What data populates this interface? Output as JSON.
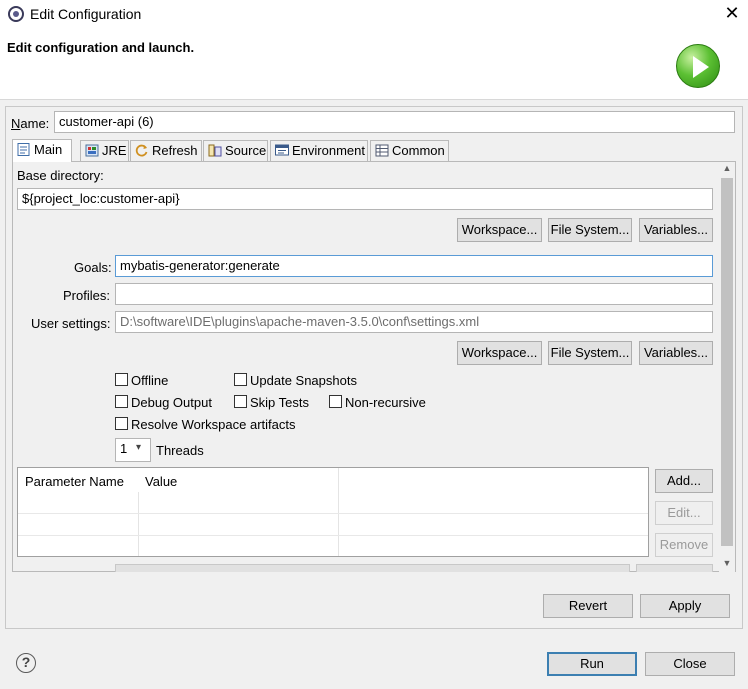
{
  "window": {
    "title": "Edit Configuration"
  },
  "header": {
    "title": "Edit configuration and launch."
  },
  "name": {
    "label": "Name:",
    "value": "customer-api (6)"
  },
  "tabs": [
    {
      "label": "Main",
      "icon": "document-icon"
    },
    {
      "label": "JRE",
      "icon": "jre-icon"
    },
    {
      "label": "Refresh",
      "icon": "refresh-icon"
    },
    {
      "label": "Source",
      "icon": "source-icon"
    },
    {
      "label": "Environment",
      "icon": "environment-icon"
    },
    {
      "label": "Common",
      "icon": "common-icon"
    }
  ],
  "main": {
    "base_directory_label": "Base directory:",
    "base_directory_value": "${project_loc:customer-api}",
    "workspace_btn": "Workspace...",
    "filesystem_btn": "File System...",
    "variables_btn": "Variables...",
    "goals_label": "Goals:",
    "goals_value": "mybatis-generator:generate",
    "profiles_label": "Profiles:",
    "profiles_value": "",
    "user_settings_label": "User settings:",
    "user_settings_value": "D:\\software\\IDE\\plugins\\apache-maven-3.5.0\\conf\\settings.xml",
    "checkboxes": {
      "offline": "Offline",
      "update_snapshots": "Update Snapshots",
      "debug_output": "Debug Output",
      "skip_tests": "Skip Tests",
      "non_recursive": "Non-recursive",
      "resolve_workspace": "Resolve Workspace artifacts"
    },
    "threads_value": "1",
    "threads_label": "Threads",
    "table": {
      "columns": [
        "Parameter Name",
        "Value"
      ]
    },
    "add_btn": "Add...",
    "edit_btn": "Edit...",
    "remove_btn": "Remove"
  },
  "footer": {
    "revert": "Revert",
    "apply": "Apply",
    "run": "Run",
    "close": "Close"
  }
}
